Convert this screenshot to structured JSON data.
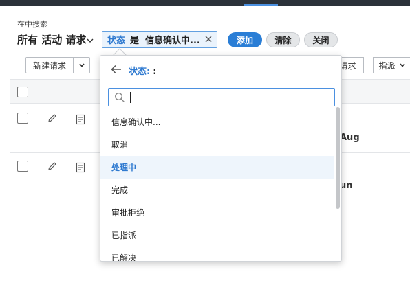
{
  "header": {
    "search_in": "在中搜索",
    "list_title": "所有 活动 请求"
  },
  "filter": {
    "field": "状态",
    "operator": "是",
    "value": "信息确认中..."
  },
  "actions": {
    "add": "添加",
    "clear": "清除",
    "close": "关闭"
  },
  "toolbar": {
    "new_request": "新建请求",
    "request": "请求",
    "assign": "指派"
  },
  "table": {
    "rows": [
      {
        "date_text": "Aug"
      },
      {
        "date_text": "un"
      }
    ]
  },
  "dropdown": {
    "title": "状态:",
    "title_suffix": ":",
    "search_value": "",
    "options": [
      "信息确认中...",
      "取消",
      "处理中",
      "完成",
      "审批拒绝",
      "已指派",
      "已解决"
    ],
    "selected": "处理中"
  },
  "colors": {
    "accent": "#2a7ed6",
    "topbar": "#2b323a",
    "selected_bg": "#eef5fc"
  }
}
